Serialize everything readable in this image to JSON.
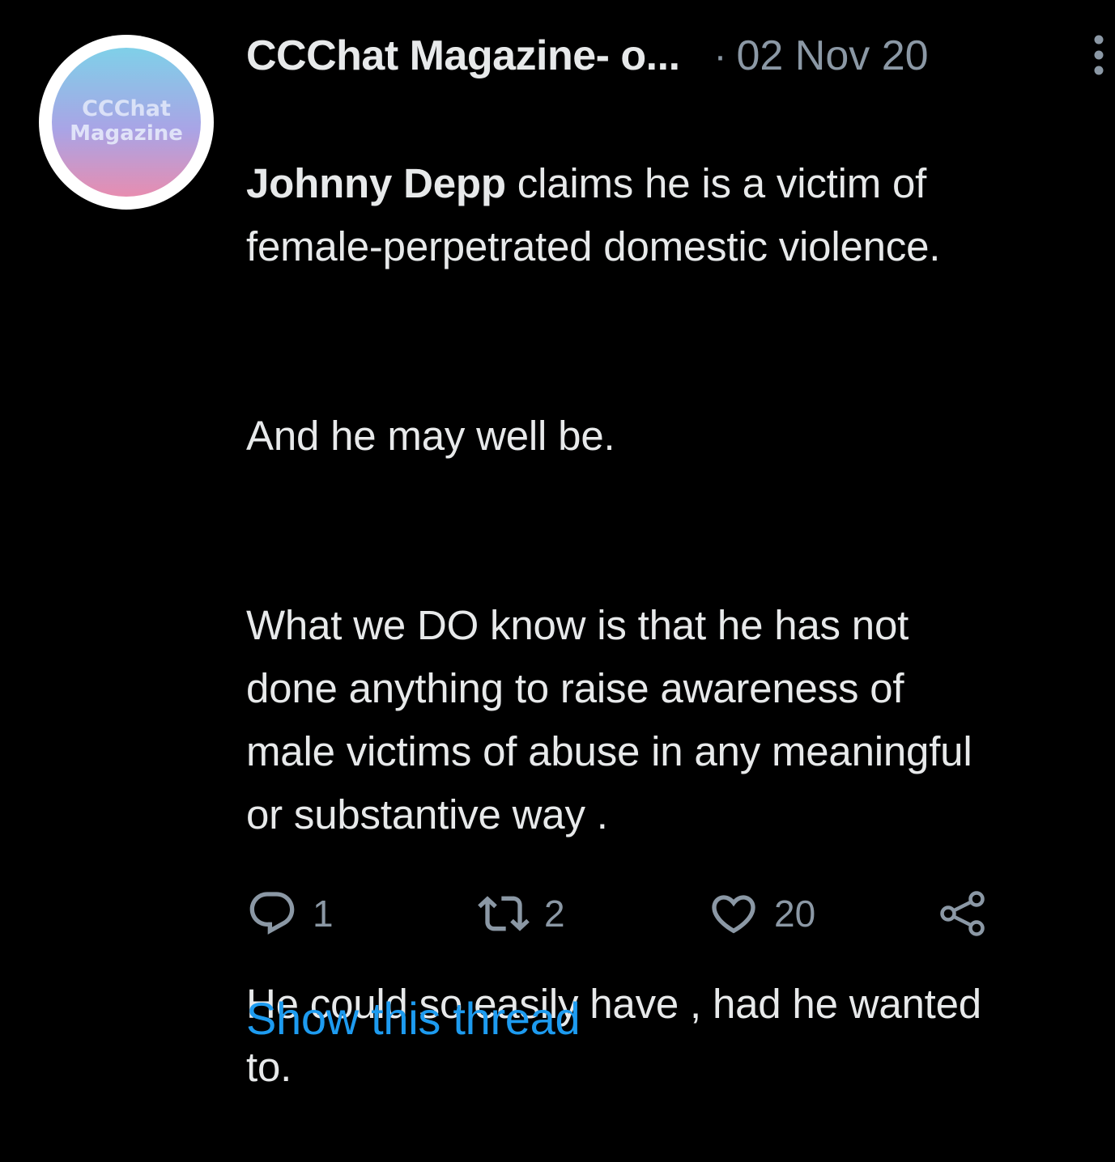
{
  "tweet": {
    "author_name": "CCChat Magazine- o...",
    "separator": "·",
    "date": "02 Nov 20",
    "avatar_text_line1": "CCChat",
    "avatar_text_line2": "Magazine",
    "mention": "Johnny Depp",
    "paragraphs": [
      " claims he is a victim of\nfemale-perpetrated domestic violence.",
      "And he may well be.",
      "What we DO know is that he  has not\ndone anything to raise awareness of\nmale victims of abuse in any meaningful\nor substantive way .",
      "He could so easily have , had he wanted\nto."
    ],
    "actions": {
      "reply_count": "1",
      "retweet_count": "2",
      "like_count": "20"
    },
    "show_thread_label": "Show this thread"
  },
  "colors": {
    "background": "#000000",
    "text_primary": "#e7e9ea",
    "text_secondary": "#8b98a5",
    "link": "#1d9bf0"
  },
  "icons": [
    "more-vertical-icon",
    "reply-icon",
    "retweet-icon",
    "like-icon",
    "share-icon"
  ]
}
